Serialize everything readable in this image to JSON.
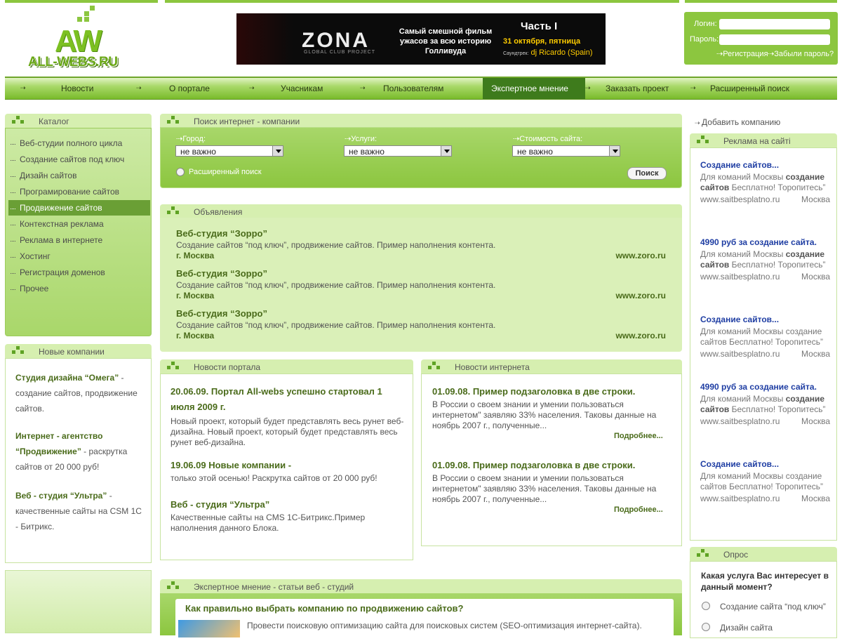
{
  "logo": {
    "big": "AW",
    "url": "ALL-WEBS.RU"
  },
  "banner": {
    "brand": "ZONA",
    "brand_sub": "GLOBAL CLUB PROJECT",
    "text": "Самый смешной фильм ужасов за всю историю Голливуда",
    "part": "Часть I",
    "date": "31 октября, пятница",
    "dj_prefix": "Саундтрек:",
    "dj": "dj Ricardo (Spain)"
  },
  "login": {
    "login_label": "Логин:",
    "password_label": "Пароль:",
    "register": "Регистрация",
    "forgot": "Забыли пароль?"
  },
  "nav": [
    "Новости",
    "О портале",
    "Учасникам",
    "Пользователям",
    "Экспертное мнение",
    "Заказать проект",
    "Расширенный поиск"
  ],
  "catalog": {
    "title": "Каталог",
    "items": [
      "Веб-студии полного цикла",
      "Создание сайтов под ключ",
      "Дизайн сайтов",
      "Програмирование сайтов",
      "Продвижение сайтов",
      "Контекстная реклама",
      "Реклама в интернете",
      "Хостинг",
      "Регистрация доменов",
      "Прочее"
    ]
  },
  "new_companies": {
    "title": "Новые компании",
    "items": [
      {
        "name": "Студия дизайна “Омега”",
        "desc": " - создание сайтов, продвижение сайтов."
      },
      {
        "name": "Интернет - агентство “Продвижение”",
        "desc": " - раскрутка сайтов от 20 000 руб!"
      },
      {
        "name": "Веб - студия “Ультра”",
        "desc": " - качественные сайты на CSM 1С - Битрикс."
      }
    ]
  },
  "search": {
    "title": "Поиск интернет - компании",
    "city_label": "Город:",
    "services_label": "Услуги:",
    "price_label": "Стоимость сайта:",
    "city_value": "не важно",
    "services_value": "не важно",
    "price_value": "не важно",
    "advanced": "Расширенный поиск",
    "button": "Поиск"
  },
  "ads": {
    "title": "Объявления",
    "items": [
      {
        "name": "Веб-студия “Зорро”",
        "desc": "Создание сайтов “под ключ”, продвижение сайтов. Пример наполнения контента.",
        "city": "г. Москва",
        "site": "www.zoro.ru"
      },
      {
        "name": "Веб-студия “Зорро”",
        "desc": "Создание сайтов “под ключ”, продвижение сайтов. Пример наполнения контента.",
        "city": "г. Москва",
        "site": "www.zoro.ru"
      },
      {
        "name": "Веб-студия “Зорро”",
        "desc": "Создание сайтов “под ключ”, продвижение сайтов. Пример наполнения контента.",
        "city": "г. Москва",
        "site": "www.zoro.ru"
      }
    ]
  },
  "portal_news": {
    "title": "Новости портала",
    "items": [
      {
        "head": "20.06.09. Портал All-webs успешно стартовал 1 июля 2009 г.",
        "body": "Новый проект, который будет представлять весь рунет веб-дизайна. Новый проект, который будет представлять весь рунет веб-дизайна."
      },
      {
        "head": "19.06.09 Новые компании -",
        "body": "только этой осенью! Раскрутка сайтов от 20 000 руб!"
      },
      {
        "head": "Веб - студия “Ультра”",
        "body": "Качественные сайты на CMS 1С-Битрикс.Пример наполнения данного Блока."
      }
    ]
  },
  "internet_news": {
    "title": "Новости интернета",
    "more": "Подробнее...",
    "items": [
      {
        "head": "01.09.08. Пример подзаголовка в две строки.",
        "body": "В России о своем знании и умении пользоваться интернетом\" заявляю 33% населения. Таковы данные на ноябрь 2007 г., полученные..."
      },
      {
        "head": "01.09.08. Пример подзаголовка в две строки.",
        "body": "В России о своем знании и умении пользоваться интернетом\" заявляю 33% населения. Таковы данные на ноябрь 2007 г., полученные..."
      }
    ]
  },
  "expert": {
    "title": "Экспертное мнение - статьи веб - студий",
    "headline": "Как правильно выбрать компанию по продвижению сайтов?",
    "text": "Провести поисковую оптимизацию сайта для поисковых систем (SEO-оптимизация интернет-сайта)."
  },
  "right": {
    "add_company": "Добавить компанию",
    "ads_title": "Реклама на сайті",
    "ads": [
      {
        "head": "Создание сайтов...",
        "pre": "Для команий Москвы ",
        "bold": "создание сайтов",
        "post": " Бесплатно! Торопитесь”",
        "domain": "www.saitbesplatno.ru",
        "city": "Москва"
      },
      {
        "head": "4990 руб за создание сайта.",
        "pre": "Для команий Москвы ",
        "bold": "создание сайтов",
        "post": " Бесплатно! Торопитесь”",
        "domain": "www.saitbesplatno.ru",
        "city": "Москва"
      },
      {
        "head": "Создание сайтов...",
        "pre": "Для команий Москвы создание сайтов Бесплатно! Торопитесь”",
        "bold": "",
        "post": "",
        "domain": "www.saitbesplatno.ru",
        "city": "Москва"
      },
      {
        "head": "4990 руб за создание сайта.",
        "pre": "Для команий Москвы ",
        "bold": "создание сайтов",
        "post": " Бесплатно! Торопитесь”",
        "domain": "www.saitbesplatno.ru",
        "city": "Москва"
      },
      {
        "head": "Создание сайтов...",
        "pre": "Для команий Москвы создание сайтов Бесплатно! Торопитесь”",
        "bold": "",
        "post": "",
        "domain": "www.saitbesplatno.ru",
        "city": "Москва"
      }
    ],
    "poll_title": "Опрос",
    "poll_question": "Какая услуга Вас интересует в данный момент?",
    "poll_options": [
      "Создание сайта “под ключ”",
      "Дизайн сайта"
    ]
  }
}
